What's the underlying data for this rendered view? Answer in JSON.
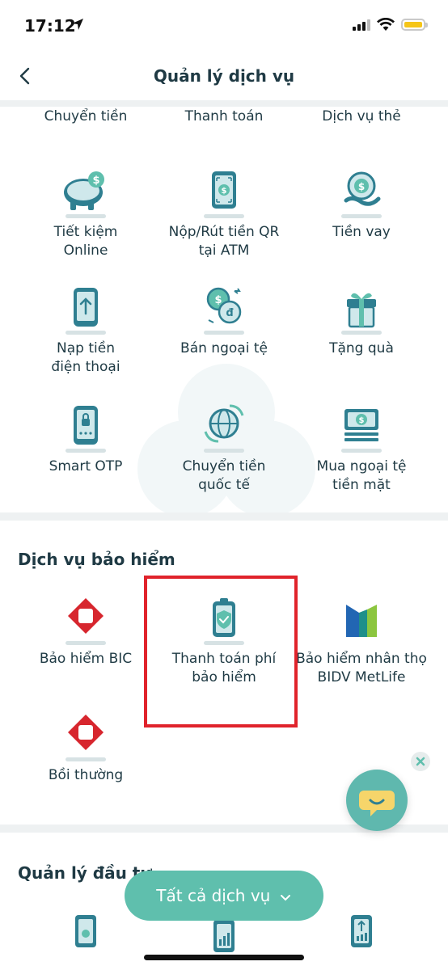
{
  "status_bar": {
    "time": "17:12"
  },
  "header": {
    "title": "Quản lý dịch vụ"
  },
  "top_row": [
    "Chuyển tiền",
    "Thanh toán",
    "Dịch vụ thẻ"
  ],
  "services": [
    {
      "label_lines": [
        "Tiết kiệm",
        "Online"
      ],
      "icon": "piggy-bank-icon"
    },
    {
      "label_lines": [
        "Nộp/Rút tiền QR",
        "tại ATM"
      ],
      "icon": "qr-atm-icon"
    },
    {
      "label_lines": [
        "Tiền vay"
      ],
      "icon": "loan-icon"
    },
    {
      "label_lines": [
        "Nạp tiền",
        "điện thoại"
      ],
      "icon": "phone-topup-icon"
    },
    {
      "label_lines": [
        "Bán ngoại tệ"
      ],
      "icon": "currency-exchange-icon"
    },
    {
      "label_lines": [
        "Tặng quà"
      ],
      "icon": "gift-icon"
    },
    {
      "label_lines": [
        "Smart OTP"
      ],
      "icon": "smart-otp-icon"
    },
    {
      "label_lines": [
        "Chuyển tiền",
        "quốc tế"
      ],
      "icon": "globe-transfer-icon"
    },
    {
      "label_lines": [
        "Mua ngoại tệ",
        "tiền mặt"
      ],
      "icon": "cash-buy-icon"
    }
  ],
  "insurance": {
    "title": "Dịch vụ bảo hiểm",
    "items": [
      {
        "label_lines": [
          "Bảo hiểm BIC"
        ],
        "icon": "bic-logo-icon"
      },
      {
        "label_lines": [
          "Thanh toán phí",
          "bảo hiểm"
        ],
        "icon": "insurance-pay-icon"
      },
      {
        "label_lines": [
          "Bảo hiểm nhân thọ",
          "BIDV MetLife"
        ],
        "icon": "metlife-logo-icon"
      },
      {
        "label_lines": [
          "Bồi thường"
        ],
        "icon": "bic-logo-icon"
      }
    ]
  },
  "investment": {
    "title": "Quản lý đầu tư"
  },
  "all_services_button": "Tất cả dịch vụ",
  "colors": {
    "accent": "#5fbfad",
    "icon_teal": "#2f7f91",
    "highlight": "#e0232b",
    "bic_red": "#d7262e"
  }
}
